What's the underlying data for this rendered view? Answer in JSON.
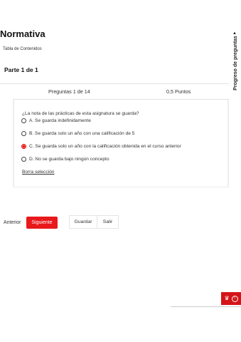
{
  "page": {
    "title": "Normativa",
    "toc_link": "Tabla de Contenidos",
    "part_heading": "Parte 1 de 1"
  },
  "question": {
    "counter": "Preguntas 1 de 14",
    "points": "0,5 Puntos",
    "text": "¿La nota de las prácticas de esta asignatura se guarda?",
    "options": [
      {
        "label": "A. Se guarda indefinidamente",
        "selected": false
      },
      {
        "label": "B. Se guarda solo un año con una calificación de 5",
        "selected": false
      },
      {
        "label": "C. Se guarda solo un año con la calificación obtenida en el curso anterior",
        "selected": true
      },
      {
        "label": "D. No se guarda bajo ningún concepto",
        "selected": false
      }
    ],
    "clear_selection": "Borra selección"
  },
  "nav": {
    "previous": "Anterior",
    "next": "Siguiente",
    "save": "Guardar",
    "exit": "Salir"
  },
  "sidebar": {
    "progress_label": "Progreso de preguntas",
    "progress_arrow_icon": "triangle-down-icon"
  },
  "corner_tab": {
    "icons": [
      "cake-icon",
      "alert-icon"
    ]
  },
  "colors": {
    "accent": "#e8181b",
    "selected_radio": "#e31b1b"
  }
}
